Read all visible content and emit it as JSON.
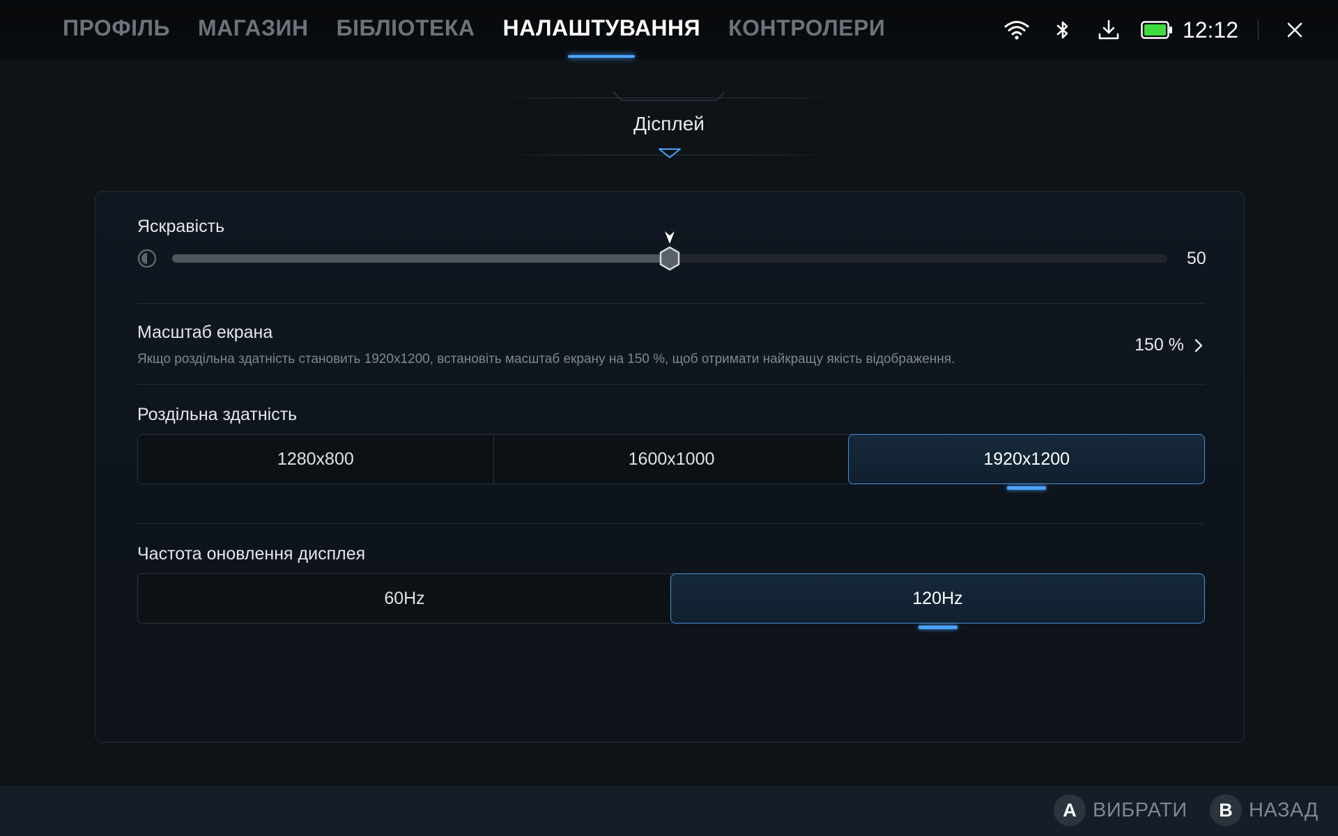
{
  "nav": {
    "tabs": [
      {
        "label": "ПРОФІЛЬ",
        "active": false
      },
      {
        "label": "МАГАЗИН",
        "active": false
      },
      {
        "label": "БІБЛІОТЕКА",
        "active": false
      },
      {
        "label": "НАЛАШТУВАННЯ",
        "active": true
      },
      {
        "label": "КОНТРОЛЕРИ",
        "active": false
      }
    ]
  },
  "status": {
    "icons": [
      "wifi-icon",
      "bluetooth-icon",
      "download-icon",
      "battery-icon"
    ],
    "time": "12:12",
    "battery_color": "#3ddc3d"
  },
  "section": {
    "title": "Дісплей"
  },
  "brightness": {
    "label": "Яскравість",
    "value": 50,
    "value_text": "50",
    "min": 0,
    "max": 100
  },
  "scale": {
    "label": "Масштаб екрана",
    "description": "Якщо роздільна здатність становить 1920x1200, встановіть масштаб екрану на 150 %, щоб отримати найкращу якість відображення.",
    "value": "150 %"
  },
  "resolution": {
    "label": "Роздільна здатність",
    "options": [
      "1280x800",
      "1600x1000",
      "1920x1200"
    ],
    "selected_index": 2
  },
  "refresh_rate": {
    "label": "Частота оновлення дисплея",
    "options": [
      "60Hz",
      "120Hz"
    ],
    "selected_index": 1
  },
  "footer": {
    "select": {
      "key": "A",
      "label": "ВИБРАТИ"
    },
    "back": {
      "key": "B",
      "label": "НАЗАД"
    }
  },
  "colors": {
    "accent": "#4aa3ff",
    "background": "#0e1318",
    "selected_border": "#4a90d9"
  }
}
